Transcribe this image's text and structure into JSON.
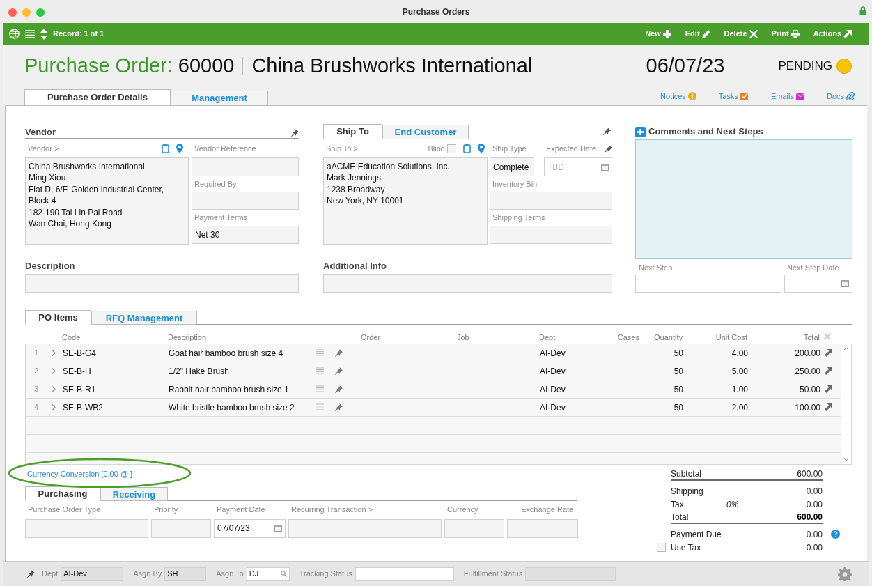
{
  "window": {
    "title": "Purchase Orders"
  },
  "toolbar": {
    "record": "Record: 1 of 1",
    "actions": [
      {
        "label": "New",
        "kind": "new"
      },
      {
        "label": "Edit",
        "kind": "edit"
      },
      {
        "label": "Delete",
        "kind": "delete"
      },
      {
        "label": "Print",
        "kind": "print"
      },
      {
        "label": "Actions",
        "kind": "actions"
      }
    ]
  },
  "header": {
    "label": "Purchase Order:",
    "number": "60000",
    "vendor": "China Brushworks International",
    "date": "06/07/23",
    "status": "PENDING"
  },
  "main_tabs": [
    {
      "label": "Purchase Order Details",
      "selected": true
    },
    {
      "label": "Management",
      "selected": false
    }
  ],
  "links": [
    {
      "label": "Notices",
      "kind": "notices"
    },
    {
      "label": "Tasks",
      "kind": "tasks"
    },
    {
      "label": "Emails",
      "kind": "emails"
    },
    {
      "label": "Docs",
      "kind": "docs"
    }
  ],
  "vendor": {
    "title": "Vendor",
    "address_label": "Vendor >",
    "address": [
      "China Brushworks International",
      "Ming Xiou",
      "Flat D, 6/F, Golden Industrial Center,",
      "Block 4",
      "182-190 Tai Lin Pai Road",
      "Wan Chai, Hong Kong"
    ],
    "fields": [
      {
        "label": "Vendor Reference"
      },
      {
        "label": "Required By"
      },
      {
        "label": "Payment Terms",
        "value": "Net 30"
      }
    ]
  },
  "description": {
    "label": "Description"
  },
  "ship": {
    "tabs": [
      {
        "label": "Ship To",
        "selected": true
      },
      {
        "label": "End Customer",
        "selected": false
      }
    ],
    "address_label": "Ship To >",
    "blind": {
      "label": "Blind",
      "checked": false
    },
    "address": [
      "aACME Education Solutions, Inc.",
      "Mark Jennings",
      "1238 Broadway",
      "New York, NY 10001"
    ],
    "ship_type": {
      "label": "Ship Type",
      "value": "Complete"
    },
    "expected_date": {
      "label": "Expected Date",
      "placeholder": "TBD"
    },
    "fields": [
      {
        "label": "Inventory Bin"
      },
      {
        "label": "Shipping Terms"
      }
    ]
  },
  "additional_info": {
    "label": "Additional Info"
  },
  "comments": {
    "title": "Comments and Next Steps",
    "next_step": {
      "label": "Next Step"
    },
    "next_step_date": {
      "label": "Next Step Date"
    }
  },
  "items_tabs": [
    {
      "label": "PO Items",
      "selected": true
    },
    {
      "label": "RFQ Management",
      "selected": false
    }
  ],
  "table": {
    "columns": [
      "Code",
      "Description",
      "Order",
      "Job",
      "Dept",
      "Cases",
      "Quantity",
      "Unit Cost",
      "Total"
    ],
    "rows": [
      {
        "index": "1",
        "code": "SE-B-G4",
        "description": "Goat hair bamboo brush size 4",
        "dept": "AI-Dev",
        "quantity": "50",
        "unit_cost": "4.00",
        "total": "200.00"
      },
      {
        "index": "2",
        "code": "SE-B-H",
        "description": "1/2\" Hake Brush",
        "dept": "AI-Dev",
        "quantity": "50",
        "unit_cost": "5.00",
        "total": "250.00"
      },
      {
        "index": "3",
        "code": "SE-B-R1",
        "description": "Rabbit hair bamboo brush size 1",
        "dept": "AI-Dev",
        "quantity": "50",
        "unit_cost": "1.00",
        "total": "50.00"
      },
      {
        "index": "4",
        "code": "SE-B-WB2",
        "description": "White bristle bamboo brush size 2",
        "dept": "AI-Dev",
        "quantity": "50",
        "unit_cost": "2.00",
        "total": "100.00"
      }
    ]
  },
  "currency_conversion": "Currency Conversion [0.00 @ ]",
  "bottom_tabs": [
    {
      "label": "Purchasing",
      "selected": true
    },
    {
      "label": "Receiving",
      "selected": false
    }
  ],
  "purchasing_fields": [
    {
      "label": "Purchase Order Type"
    },
    {
      "label": "Priority"
    },
    {
      "label": "Payment Date",
      "value": "07/07/23",
      "kind": "date"
    },
    {
      "label": "Recurring Transaction >"
    },
    {
      "label": "Currency"
    },
    {
      "label": "Exchange Rate"
    }
  ],
  "totals": [
    {
      "label": "Subtotal",
      "value": "600.00",
      "kind": "subtotal"
    },
    {
      "label": "Shipping",
      "value": "0.00",
      "kind": "line"
    },
    {
      "label": "Tax",
      "rate": "0%",
      "value": "0.00",
      "kind": "line"
    },
    {
      "label": "Total",
      "value": "600.00",
      "kind": "total"
    },
    {
      "label": "Payment Due",
      "value": "0.00",
      "kind": "due"
    }
  ],
  "use_tax": {
    "label": "Use Tax",
    "checked": false,
    "value": "0.00"
  },
  "footer": {
    "fields": [
      {
        "label": "Dept",
        "value": "AI-Dev"
      },
      {
        "label": "Asgn By",
        "value": "SH"
      },
      {
        "label": "Asgn To",
        "value": "DJ",
        "kind": "lookup"
      },
      {
        "label": "Tracking Status"
      },
      {
        "label": "Fulfillment Status"
      }
    ]
  }
}
